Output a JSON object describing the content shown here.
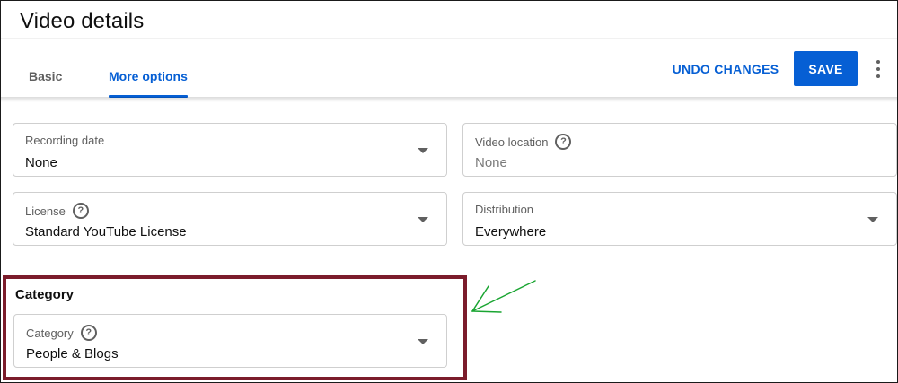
{
  "header": {
    "title": "Video details",
    "tabs": [
      {
        "label": "Basic",
        "active": false
      },
      {
        "label": "More options",
        "active": true
      }
    ],
    "undo_label": "UNDO CHANGES",
    "save_label": "SAVE",
    "more_icon": "more-vert-icon"
  },
  "fields": {
    "recording_date": {
      "label": "Recording date",
      "value": "None"
    },
    "video_location": {
      "label": "Video location",
      "placeholder": "None",
      "help_icon": "help-icon"
    },
    "license": {
      "label": "License",
      "value": "Standard YouTube License",
      "help_icon": "help-icon"
    },
    "distribution": {
      "label": "Distribution",
      "value": "Everywhere"
    }
  },
  "category_section": {
    "heading": "Category",
    "field": {
      "label": "Category",
      "value": "People & Blogs",
      "help_icon": "help-icon"
    }
  },
  "help_glyph": "?",
  "annotation": {
    "arrow_color": "#1aa532",
    "highlight_color": "#7b1c2b"
  },
  "colors": {
    "accent": "#065fd4",
    "text_secondary": "#606060"
  }
}
